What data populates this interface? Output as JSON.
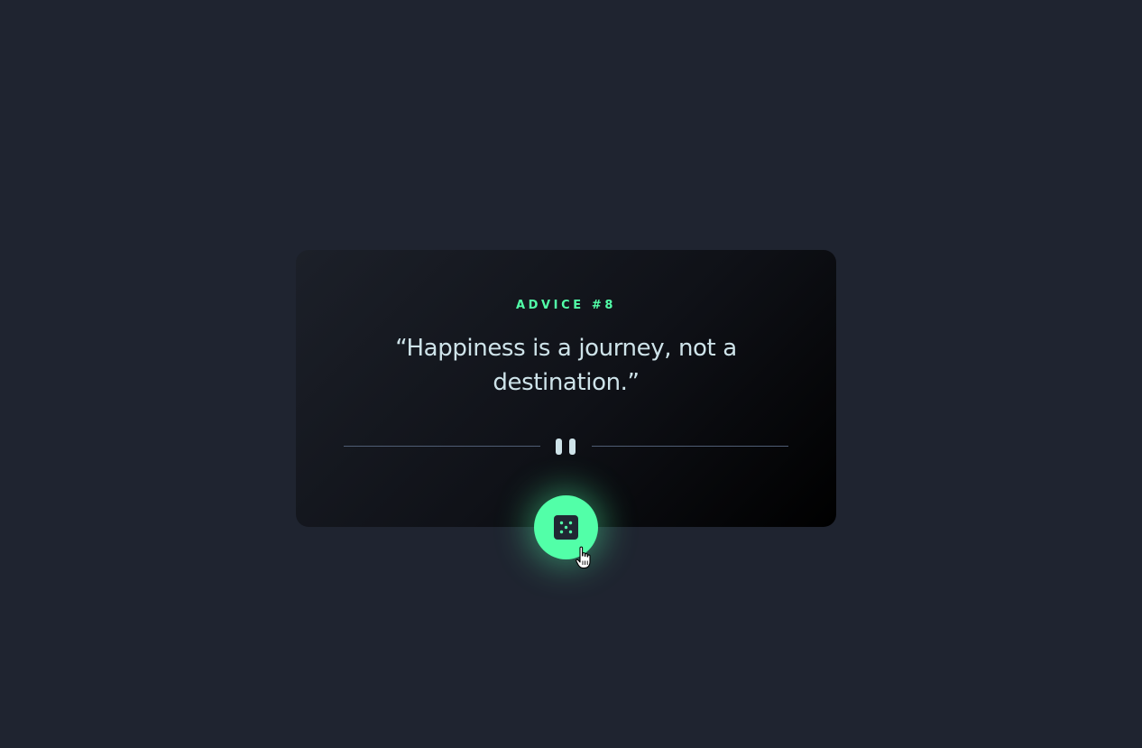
{
  "advice": {
    "label": "ADVICE #8",
    "quote": "“Happiness is a journey, not a destination.”"
  },
  "button": {
    "icon": "dice-icon",
    "accent_color": "#52ffa8"
  },
  "divider": {
    "icon": "pause-icon"
  },
  "colors": {
    "background": "#1f2430",
    "text": "#cee3e9",
    "accent": "#52ffa8",
    "divider": "#4f5d74"
  }
}
